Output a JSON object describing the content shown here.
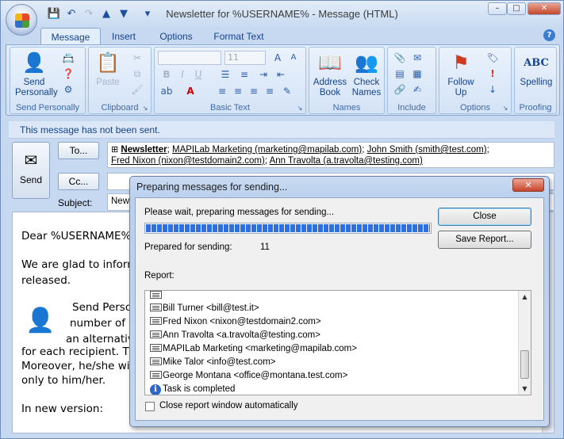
{
  "window": {
    "title": "Newsletter for %USERNAME% - Message (HTML)",
    "controls": {
      "minimize": "–",
      "maximize": "□",
      "close": "✕"
    }
  },
  "qat": {
    "dropdown": "▾"
  },
  "ribbon": {
    "tabs": [
      "Message",
      "Insert",
      "Options",
      "Format Text"
    ],
    "active_tab": "Message",
    "help": "?",
    "groups": {
      "send_personally": {
        "label": "Send Personally",
        "button": "Send Personally"
      },
      "clipboard": {
        "label": "Clipboard",
        "paste": "Paste"
      },
      "basic_text": {
        "label": "Basic Text",
        "font_size": "11"
      },
      "names": {
        "label": "Names",
        "address_book": "Address Book",
        "check_names": "Check Names"
      },
      "include": {
        "label": "Include"
      },
      "options": {
        "label": "Options",
        "follow_up": "Follow Up"
      },
      "proofing": {
        "label": "Proofing",
        "spelling": "Spelling"
      }
    }
  },
  "notice": "This message has not been sent.",
  "compose": {
    "send": "Send",
    "to_button": "To...",
    "cc_button": "Cc...",
    "subject_label": "Subject:",
    "subject_value": "New",
    "to": {
      "expand": "⊞",
      "group": "Newsletter",
      "r1": "MAPILab Marketing (marketing@mapilab.com)",
      "r2": "John Smith (smith@test.com)",
      "r3": "Fred Nixon (nixon@testdomain2.com)",
      "r4": "Ann Travolta (a.travolta@testing.com)"
    }
  },
  "body": {
    "greeting": "Dear %USERNAME%.",
    "line1": "We are glad to inform y",
    "line2": "released.",
    "line3": "Send Person",
    "line4": "number of re",
    "line5": "an alternativ",
    "line6": "for each recipient. The",
    "line7": "Moreover, he/she will",
    "line8": "only to him/her.",
    "line9": "In new version:"
  },
  "dialog": {
    "title": "Preparing messages for sending...",
    "status": "Please wait, preparing messages for sending...",
    "progress": 1.0,
    "prepared_label": "Prepared for sending:",
    "prepared_count": "11",
    "report_label": "Report:",
    "close_button": "Close",
    "save_button": "Save Report...",
    "report": [
      "Bill Turner <bill@test.it>",
      "Fred Nixon <nixon@testdomain2.com>",
      "Ann Travolta <a.travolta@testing.com>",
      "MAPILab Marketing <marketing@mapilab.com>",
      "Mike Talor <info@test.com>",
      "George Montana <office@montana.test.com>"
    ],
    "complete": "Task is completed",
    "auto_close": "Close report window automatically"
  },
  "colors": {
    "accent": "#15428b",
    "progress": "#2f6fe0",
    "notice_bg": "#dce8f7"
  }
}
